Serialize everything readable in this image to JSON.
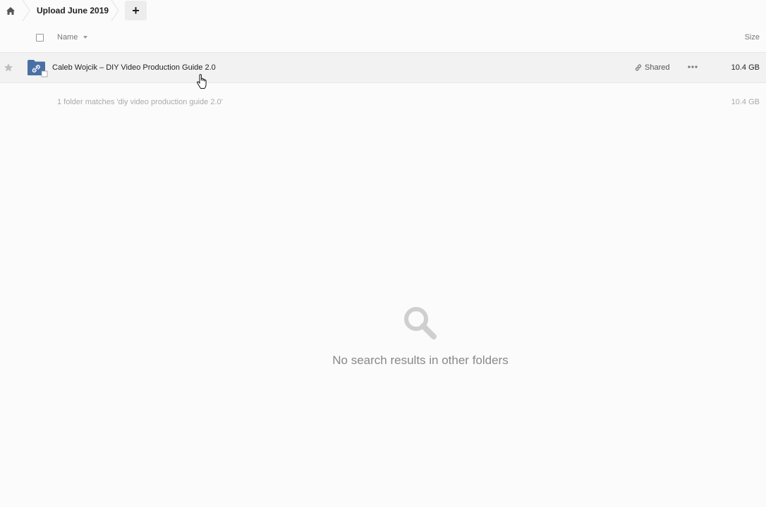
{
  "breadcrumb": {
    "current": "Upload June 2019"
  },
  "toolbar": {
    "add_label": "+"
  },
  "table": {
    "columns": {
      "name": "Name",
      "size": "Size"
    },
    "rows": [
      {
        "name": "Caleb Wojcik – DIY Video Production Guide 2.0",
        "share_label": "Shared",
        "size": "10.4 GB",
        "icon": "shared-folder-icon"
      }
    ],
    "summary": {
      "text": "1 folder matches 'diy video production guide 2.0'",
      "size": "10.4 GB"
    }
  },
  "empty_state": {
    "icon": "search-icon",
    "message": "No search results in other folders"
  },
  "colors": {
    "folder_blue": "#4a6fa5",
    "row_highlight": "#f2f2f2",
    "muted_text": "#aaaaaa"
  }
}
